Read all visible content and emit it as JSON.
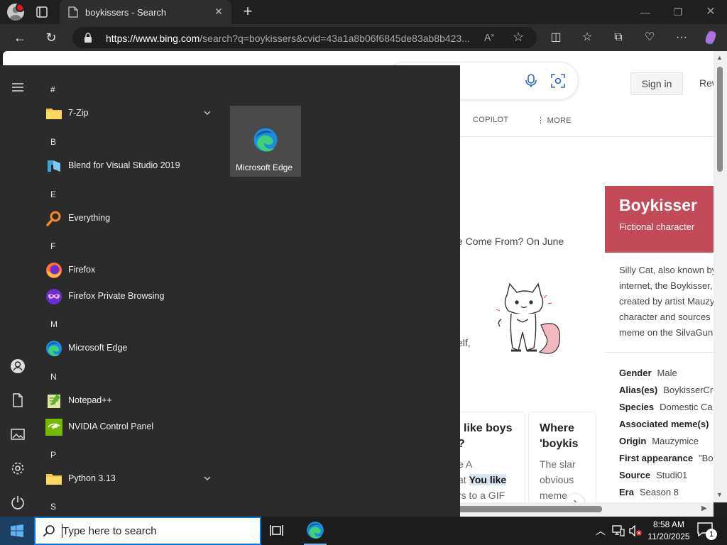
{
  "browser": {
    "tab_title": "boykissers - Search",
    "url_host": "https://www.bing.com",
    "url_path": "/search?q=boykissers&cvid=43a1a8b06f6845de83ab8b423..."
  },
  "bing": {
    "sign_in": "Sign in",
    "rewards": "Rew",
    "scopes": [
      "COPILOT",
      "MORE"
    ],
    "snippet_top": "e Come From? On June",
    "snippet_mid": "elf,",
    "cards": [
      {
        "title_lines": [
          "like boys",
          "?"
        ],
        "body_lines": [
          "e A",
          "at ",
          " to a GIF"
        ],
        "highlight": "You like",
        "body_prefix_2": "rs"
      },
      {
        "title_lines": [
          "Where",
          "'boykis"
        ],
        "body_lines": [
          "The slar",
          "obvious",
          "meme"
        ]
      }
    ],
    "knowledge_panel": {
      "title": "Boykisser",
      "subtitle": "Fictional character",
      "description": [
        "Silly Cat, also known by",
        "internet, the Boykisser,",
        "created by artist Mauzy",
        "character and sources",
        "meme on the SilvaGunn"
      ],
      "facts": [
        {
          "key": "Gender",
          "value": "Male"
        },
        {
          "key": "Alias(es)",
          "value": "BoykisserCr"
        },
        {
          "key": "Species",
          "value": "Domestic Ca"
        },
        {
          "key": "Associated meme(s)",
          "value": ""
        },
        {
          "key": "Origin",
          "value": "Mauzymice"
        },
        {
          "key": "First appearance",
          "value": "\"Boy"
        },
        {
          "key": "Source",
          "value": "Studi01"
        },
        {
          "key": "Era",
          "value": "Season 8"
        }
      ]
    }
  },
  "start_menu": {
    "groups": [
      {
        "letter": "#",
        "apps": [
          {
            "name": "7-Zip",
            "icon": "folder-icon",
            "expandable": true
          }
        ]
      },
      {
        "letter": "B",
        "apps": [
          {
            "name": "Blend for Visual Studio 2019",
            "icon": "blend-icon"
          }
        ]
      },
      {
        "letter": "E",
        "apps": [
          {
            "name": "Everything",
            "icon": "everything-icon"
          }
        ]
      },
      {
        "letter": "F",
        "apps": [
          {
            "name": "Firefox",
            "icon": "firefox-icon"
          },
          {
            "name": "Firefox Private Browsing",
            "icon": "firefox-private-icon"
          }
        ]
      },
      {
        "letter": "M",
        "apps": [
          {
            "name": "Microsoft Edge",
            "icon": "edge-icon"
          }
        ]
      },
      {
        "letter": "N",
        "apps": [
          {
            "name": "Notepad++",
            "icon": "notepadpp-icon"
          },
          {
            "name": "NVIDIA Control Panel",
            "icon": "nvidia-icon"
          }
        ]
      },
      {
        "letter": "P",
        "apps": [
          {
            "name": "Python 3.13",
            "icon": "folder-icon",
            "expandable": true
          }
        ]
      },
      {
        "letter": "S",
        "apps": []
      }
    ],
    "pinned_tile": {
      "name": "Microsoft Edge"
    }
  },
  "taskbar": {
    "search_placeholder": "Type here to search",
    "time": "8:58 AM",
    "date": "11/20/2025",
    "notification_count": "1"
  },
  "colors": {
    "start_menu_bg": "#2b2b2b",
    "kp_header": "#c34a57",
    "taskbar": "#1c1c1c",
    "accent": "#0a74d4"
  }
}
